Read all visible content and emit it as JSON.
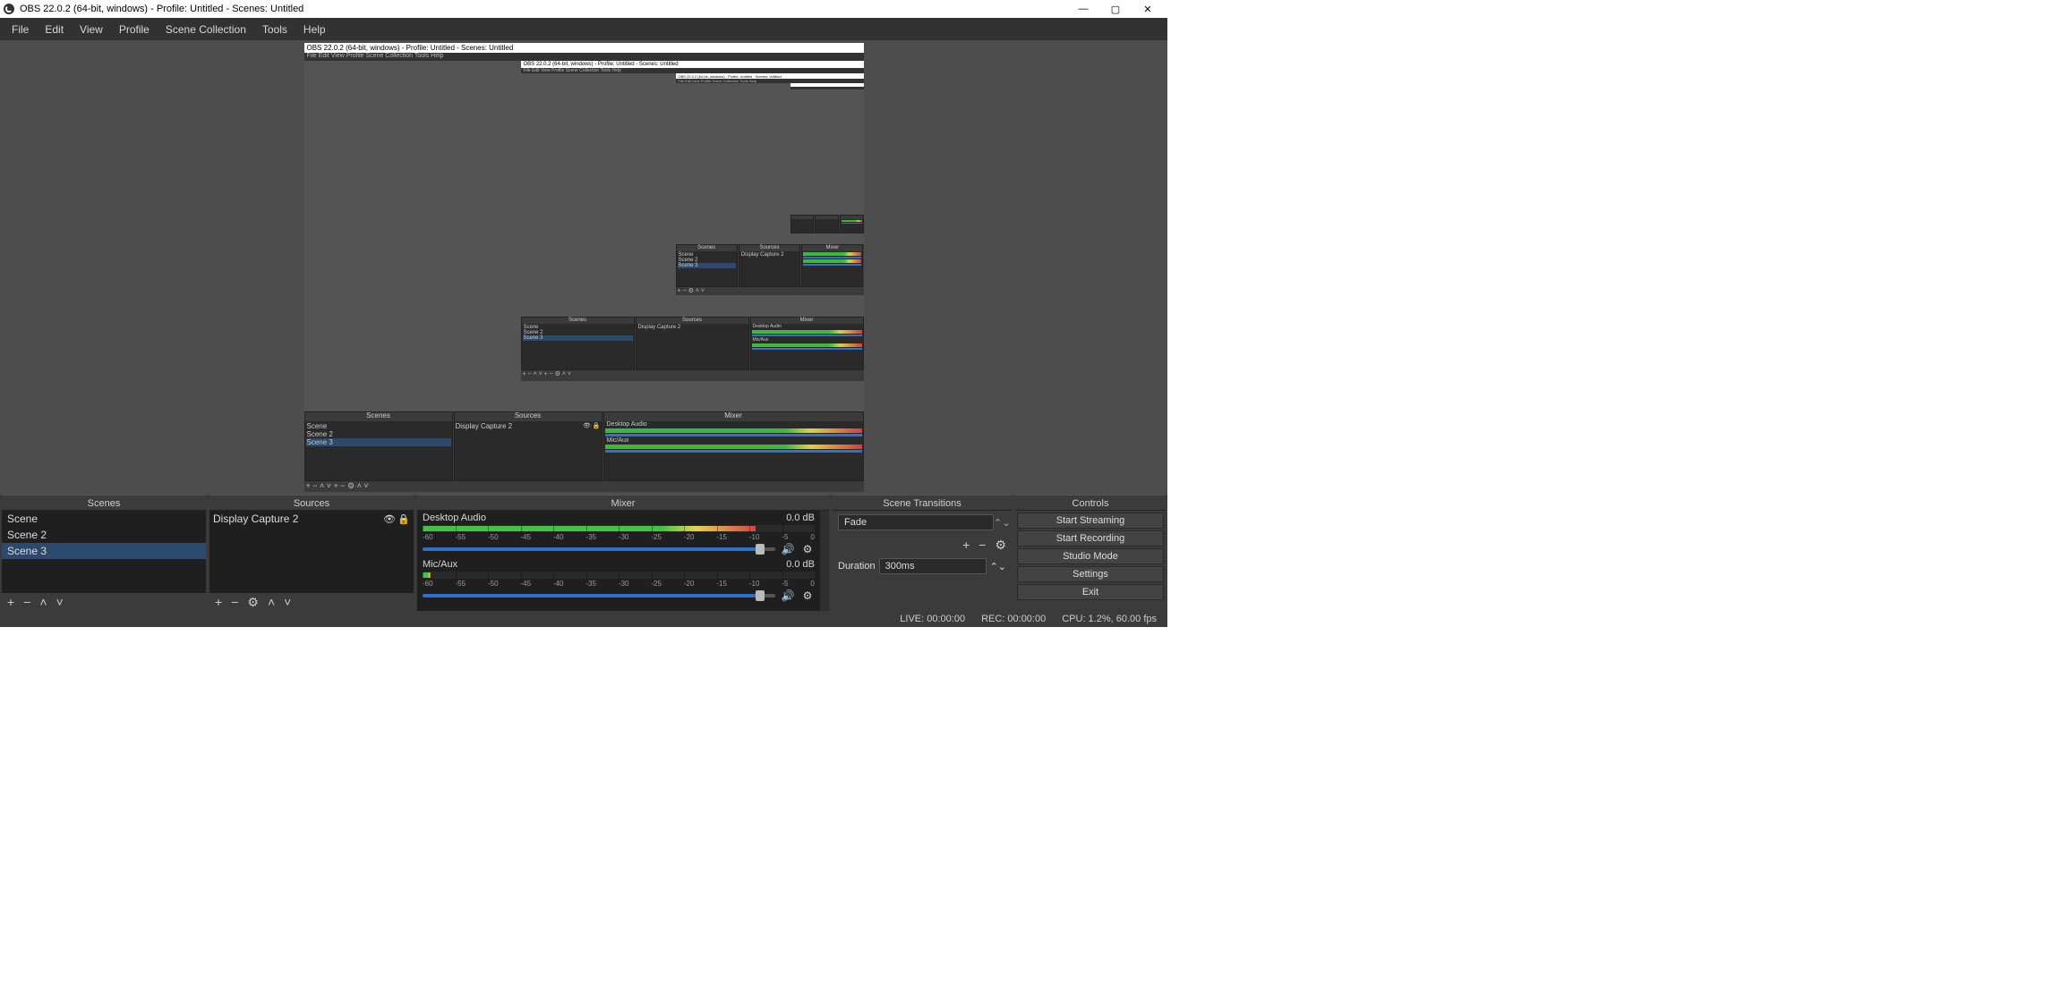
{
  "window": {
    "title": "OBS 22.0.2 (64-bit, windows) - Profile: Untitled - Scenes: Untitled"
  },
  "menu": {
    "file": "File",
    "edit": "Edit",
    "view": "View",
    "profile": "Profile",
    "scene_collection": "Scene Collection",
    "tools": "Tools",
    "help": "Help"
  },
  "panels": {
    "scenes": {
      "title": "Scenes",
      "items": [
        "Scene",
        "Scene 2",
        "Scene 3"
      ],
      "selected": 2
    },
    "sources": {
      "title": "Sources",
      "items": [
        {
          "name": "Display Capture 2",
          "visible": true,
          "locked": true
        }
      ]
    },
    "mixer": {
      "title": "Mixer",
      "tracks": [
        {
          "name": "Desktop Audio",
          "db": "0.0 dB",
          "scale": [
            "-60",
            "-55",
            "-50",
            "-45",
            "-40",
            "-35",
            "-30",
            "-25",
            "-20",
            "-15",
            "-10",
            "-5",
            "0"
          ]
        },
        {
          "name": "Mic/Aux",
          "db": "0.0 dB",
          "scale": [
            "-60",
            "-55",
            "-50",
            "-45",
            "-40",
            "-35",
            "-30",
            "-25",
            "-20",
            "-15",
            "-10",
            "-5",
            "0"
          ]
        }
      ]
    },
    "transitions": {
      "title": "Scene Transitions",
      "selected": "Fade",
      "duration_label": "Duration",
      "duration": "300ms"
    },
    "controls": {
      "title": "Controls",
      "buttons": [
        "Start Streaming",
        "Start Recording",
        "Studio Mode",
        "Settings",
        "Exit"
      ]
    }
  },
  "preview_recursive": {
    "title": "OBS 22.0.2 (64-bit, windows) - Profile: Untitled - Scenes: Untitled",
    "menu": "File   Edit   View   Profile   Scene Collection   Tools   Help",
    "scenes": [
      "Scene",
      "Scene 2",
      "Scene 3"
    ],
    "source": "Display Capture 2",
    "mixer": [
      "Desktop Audio",
      "Mic/Aux"
    ],
    "panel_titles": {
      "scenes": "Scenes",
      "sources": "Sources",
      "mixer": "Mixer"
    }
  },
  "status": {
    "live": "LIVE: 00:00:00",
    "rec": "REC: 00:00:00",
    "cpu": "CPU: 1.2%, 60.00 fps"
  },
  "toolbar_glyphs": {
    "plus": "+",
    "minus": "−",
    "gear": "⚙",
    "up": "˄",
    "down": "˅",
    "eye": "👁",
    "lock": "🔒",
    "speaker": "🔊"
  }
}
